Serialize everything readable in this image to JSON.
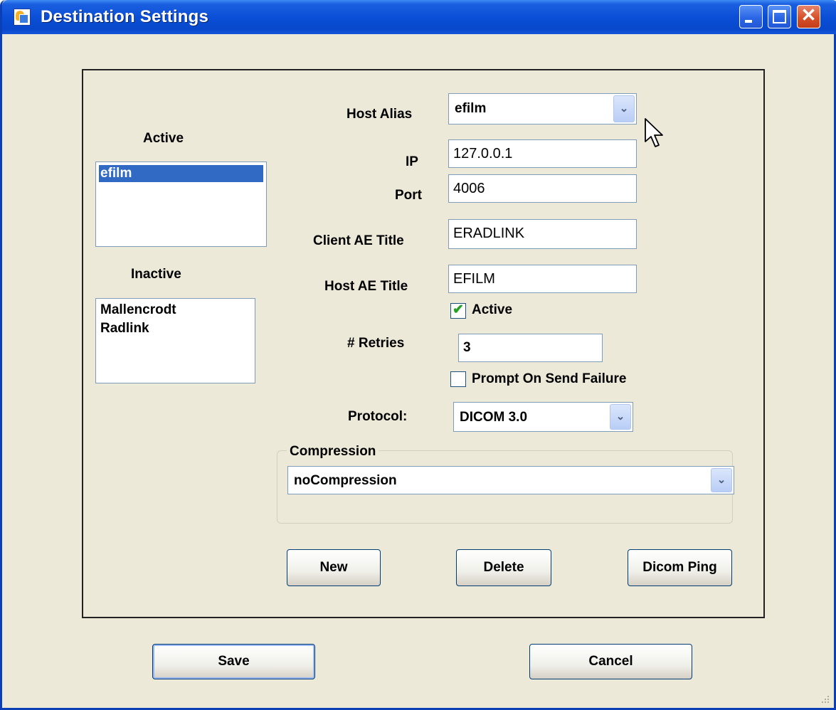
{
  "window": {
    "title": "Destination Settings"
  },
  "lists": {
    "active_label": "Active",
    "active_items": [
      "efilm"
    ],
    "inactive_label": "Inactive",
    "inactive_items": [
      "Mallencrodt",
      "Radlink"
    ]
  },
  "form": {
    "host_alias_label": "Host Alias",
    "host_alias_value": "efilm",
    "ip_label": "IP",
    "ip_value": "127.0.0.1",
    "port_label": "Port",
    "port_value": "4006",
    "client_ae_label": "Client AE Title",
    "client_ae_value": "ERADLINK",
    "host_ae_label": "Host AE Title",
    "host_ae_value": "EFILM",
    "active_checkbox_label": "Active",
    "active_checked": true,
    "retries_label": "# Retries",
    "retries_value": "3",
    "prompt_checkbox_label": "Prompt On Send Failure",
    "prompt_checked": false,
    "protocol_label": "Protocol:",
    "protocol_value": "DICOM 3.0"
  },
  "compression": {
    "legend": "Compression",
    "value": "noCompression"
  },
  "actions": {
    "new_label": "New",
    "delete_label": "Delete",
    "ping_label": "Dicom Ping"
  },
  "footer": {
    "save_label": "Save",
    "cancel_label": "Cancel"
  },
  "icons": {
    "dropdown": "chevron-down-icon",
    "check": "checkmark-icon",
    "minimize": "minimize-icon",
    "maximize": "maximize-icon",
    "close": "close-icon",
    "app": "app-icon"
  },
  "colors": {
    "titlebar": "#0a4fd6",
    "selection": "#316ac5",
    "face": "#ece9d8",
    "close": "#d6502a",
    "checkmark": "#21a121"
  }
}
